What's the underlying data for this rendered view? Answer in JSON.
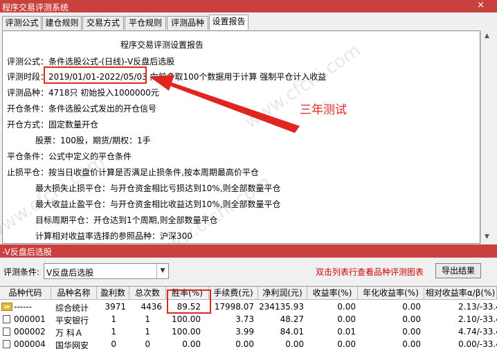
{
  "window": {
    "title": "程序交易评测系统",
    "close_label": "×"
  },
  "tabs": [
    {
      "label": "评测公式"
    },
    {
      "label": "建仓规则"
    },
    {
      "label": "交易方式"
    },
    {
      "label": "平仓规则"
    },
    {
      "label": "评测品种"
    },
    {
      "label": "设置报告"
    }
  ],
  "report": {
    "heading": "程序交易评测设置报告",
    "lines": [
      "评测公式：条件选股公式-(日线)-V反盘后选股",
      "评测时段：2019/01/01-2022/05/03 向前多取100个数据用于计算 强制平仓计入收益",
      "评测品种：4718只 初始投入1000000元",
      "开仓条件：条件选股公式发出的开仓信号",
      "开仓方式：固定数量开仓",
      "股票：100股，期货/期权：1手",
      "平仓条件：公式中定义的平仓条件",
      "止损平仓：按当日收盘价计算是否满足止损条件,按本周期最高价平仓",
      "最大损失止损平仓：与开仓资金相比亏损达到10%,则全部数量平仓",
      "最大收益止盈平仓：与开仓资金相比收益达到10%,则全部数量平仓",
      "目标周期平仓：开仓达到1个周期,则全部数量平仓",
      "计算相对收益率选择的参照品种：沪深300"
    ]
  },
  "annotation": {
    "text": "三年测试",
    "color": "#e0261f"
  },
  "watermark": "www.cfchi.com",
  "section": {
    "title": "-V反盘后选股"
  },
  "conditions": {
    "label": "评测条件:",
    "selected": "V反盘后选股",
    "hint": "双击列表行查看品种评测图表",
    "export_label": "导出结果"
  },
  "table": {
    "columns": [
      "品种代码",
      "品种名称",
      "盈利数",
      "总次数",
      "胜率(%)",
      "手续费(元)",
      "净利润(元)",
      "收益率(%)",
      "年化收益率(%)",
      "相对收益率α/β(%)"
    ],
    "rows": [
      {
        "icon": "folder-icon",
        "code": "------",
        "name": "综合统计",
        "win": "3971",
        "total": "4436",
        "rate": "89.52",
        "fee": "17998.07",
        "profit": "234135.93",
        "ret": "0.00",
        "annual": "0.00",
        "rel": "2.13/-33.4"
      },
      {
        "icon": "stock-icon",
        "code": "000001",
        "name": "平安银行",
        "win": "1",
        "total": "1",
        "rate": "100.00",
        "fee": "3.73",
        "profit": "48.27",
        "ret": "0.00",
        "annual": "0.00",
        "rel": "2.10/-33.4"
      },
      {
        "icon": "stock-icon",
        "code": "000002",
        "name": "万 科Ａ",
        "win": "1",
        "total": "1",
        "rate": "100.00",
        "fee": "3.99",
        "profit": "84.01",
        "ret": "0.01",
        "annual": "0.00",
        "rel": "4.74/-33.4"
      },
      {
        "icon": "stock-icon",
        "code": "000004",
        "name": "国华网安",
        "win": "0",
        "total": "0",
        "rate": "0.00",
        "fee": "0.00",
        "profit": "0.00",
        "ret": "0.00",
        "annual": "0.00",
        "rel": "0.00/-33.4"
      }
    ]
  }
}
